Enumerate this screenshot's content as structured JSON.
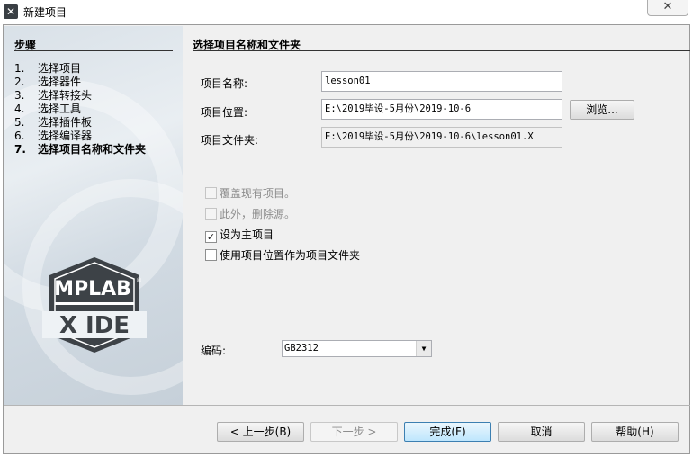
{
  "window": {
    "title": "新建项目",
    "close_glyph": "✕"
  },
  "steps": {
    "title": "步骤",
    "items": [
      {
        "num": "1.",
        "label": "选择项目"
      },
      {
        "num": "2.",
        "label": "选择器件"
      },
      {
        "num": "3.",
        "label": "选择转接头"
      },
      {
        "num": "4.",
        "label": "选择工具"
      },
      {
        "num": "5.",
        "label": "选择插件板"
      },
      {
        "num": "6.",
        "label": "选择编译器"
      },
      {
        "num": "7.",
        "label": "选择项目名称和文件夹"
      }
    ],
    "current_index": 6
  },
  "logo": {
    "line1": "MPLAB",
    "line2": "X IDE",
    "registered": "®"
  },
  "main": {
    "section_title": "选择项目名称和文件夹",
    "project_name": {
      "label": "项目名称:",
      "value": "lesson01"
    },
    "project_location": {
      "label": "项目位置:",
      "value": "E:\\2019毕设-5月份\\2019-10-6"
    },
    "browse_button": "浏览...",
    "project_folder": {
      "label": "项目文件夹:",
      "value": "E:\\2019毕设-5月份\\2019-10-6\\lesson01.X"
    },
    "checkboxes": [
      {
        "label": "覆盖现有项目。",
        "checked": false,
        "enabled": false
      },
      {
        "label": "此外，删除源。",
        "checked": false,
        "enabled": false
      },
      {
        "label": "设为主项目",
        "checked": true,
        "enabled": true
      },
      {
        "label": "使用项目位置作为项目文件夹",
        "checked": false,
        "enabled": true
      }
    ],
    "encoding": {
      "label": "编码:",
      "value": "GB2312"
    }
  },
  "footer": {
    "back": "< 上一步(B)",
    "next": "下一步 >",
    "finish": "完成(F)",
    "cancel": "取消",
    "help": "帮助(H)"
  },
  "colors": {
    "logo_dark": "#3d4247",
    "logo_light": "#ffffff",
    "primary_button_border": "#3c7fb1"
  }
}
